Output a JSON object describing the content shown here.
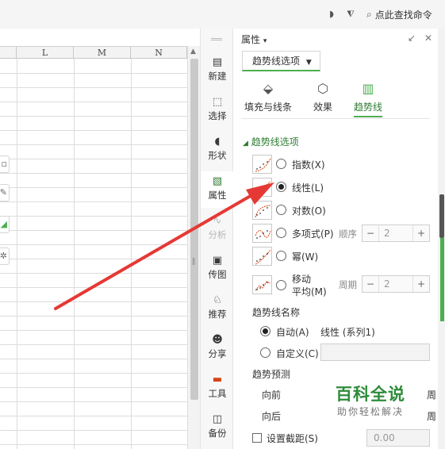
{
  "topbar": {
    "command_search": "点此查找命令"
  },
  "sheet": {
    "columns": [
      "L",
      "M",
      "N"
    ]
  },
  "sidebar": {
    "items": [
      {
        "label": "新建",
        "icon": "new-doc-icon"
      },
      {
        "label": "选择",
        "icon": "select-icon"
      },
      {
        "label": "形状",
        "icon": "shape-icon"
      },
      {
        "label": "属性",
        "icon": "property-icon"
      },
      {
        "label": "分析",
        "icon": "analysis-icon"
      },
      {
        "label": "传图",
        "icon": "upload-image-icon"
      },
      {
        "label": "推荐",
        "icon": "recommend-icon"
      },
      {
        "label": "分享",
        "icon": "share-icon"
      },
      {
        "label": "工具",
        "icon": "toolbox-icon"
      },
      {
        "label": "备份",
        "icon": "backup-icon"
      }
    ]
  },
  "panel": {
    "title": "属性",
    "title_arrow": "▾",
    "dropdown": "趋势线选项",
    "mode_tabs": [
      {
        "label": "填充与线条",
        "icon": "paint-bucket-icon"
      },
      {
        "label": "效果",
        "icon": "cube-icon"
      },
      {
        "label": "趋势线",
        "icon": "bar-chart-icon"
      }
    ],
    "section_title": "趋势线选项",
    "trend_types": [
      {
        "label": "指数(X)",
        "checked": false
      },
      {
        "label": "线性(L)",
        "checked": true
      },
      {
        "label": "对数(O)",
        "checked": false
      },
      {
        "label": "多项式(P)",
        "checked": false
      },
      {
        "label": "幂(W)",
        "checked": false
      },
      {
        "label": "移动",
        "label2": "平均(M)",
        "checked": false
      }
    ],
    "polynomial": {
      "order_label": "顺序",
      "value": "2"
    },
    "moving_avg": {
      "period_label": "周期",
      "value": "2"
    },
    "name_section": {
      "title": "趋势线名称",
      "auto_label": "自动(A)",
      "auto_value": "线性 (系列1)",
      "custom_label": "自定义(C)"
    },
    "forecast": {
      "title": "趋势预测",
      "forward_label": "向前",
      "backward_label": "向后",
      "unit": "周"
    },
    "intercept": {
      "label": "设置截距(S)",
      "value": "0.00"
    }
  },
  "watermark": {
    "title": "百科全说",
    "subtitle": "助你轻松解决"
  },
  "colors": {
    "accent": "#4caf50",
    "arrow": "#e53935"
  }
}
